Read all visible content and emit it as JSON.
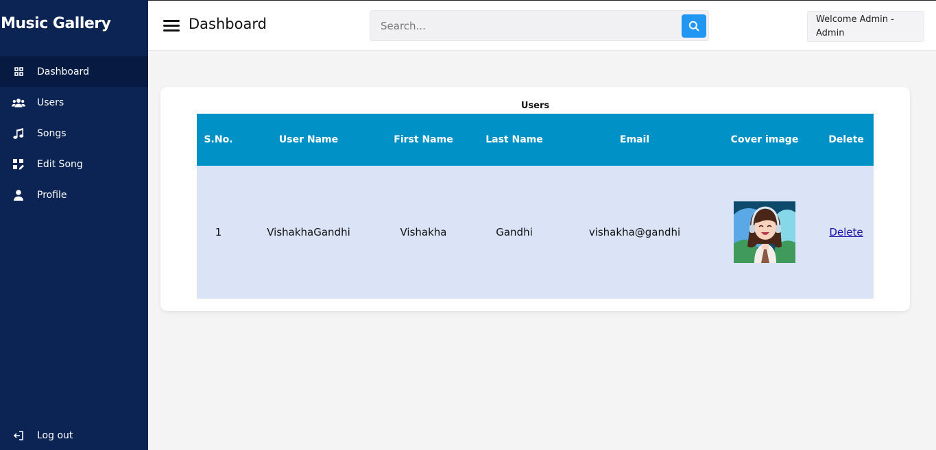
{
  "brand": "Music Gallery",
  "nav": {
    "items": [
      {
        "label": "Dashboard",
        "icon": "grid-icon"
      },
      {
        "label": "Users",
        "icon": "users-icon"
      },
      {
        "label": "Songs",
        "icon": "music-note-icon"
      },
      {
        "label": "Edit Song",
        "icon": "edit-grid-icon"
      },
      {
        "label": "Profile",
        "icon": "user-icon"
      }
    ],
    "logout": "Log out"
  },
  "header": {
    "title": "Dashboard",
    "search_placeholder": "Search...",
    "welcome": "Welcome Admin - Admin"
  },
  "users_table": {
    "caption": "Users",
    "columns": [
      "S.No.",
      "User Name",
      "First Name",
      "Last Name",
      "Email",
      "Cover image",
      "Delete"
    ],
    "rows": [
      {
        "sno": "1",
        "username": "VishakhaGandhi",
        "first": "Vishakha",
        "last": "Gandhi",
        "email": "vishakha@gandhi",
        "delete": "Delete"
      }
    ]
  },
  "colors": {
    "sidebar": "#0b2454",
    "sidebar_active": "#061a42",
    "table_header": "#0091c7",
    "table_row": "#dbe3f6",
    "search_button": "#2196f3"
  }
}
